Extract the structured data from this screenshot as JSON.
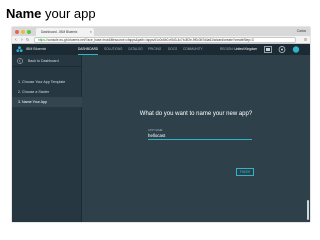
{
  "slide": {
    "heading_bold": "Name",
    "heading_rest": " your app"
  },
  "browser": {
    "tab_title": "Dashboard - IBM Bluemix",
    "tab_close": "×",
    "user": "Carlos",
    "url_scheme": "https://",
    "url_rest": "console.eu-gb.bluemix.net/?ace_base=true&filesource=cfapps&path=/apps/d1c0c6b0-e5d3-4c7b-8f2e-9f0c3b7d4a61/wizard/create?createStep=3",
    "back_icon": "back-arrow",
    "forward_icon": "forward-arrow",
    "reload_icon": "reload"
  },
  "topnav": {
    "brand": "IBM Bluemix",
    "items": [
      "DASHBOARD",
      "SOLUTIONS",
      "CATALOG",
      "PRICING",
      "DOCS",
      "COMMUNITY"
    ],
    "active_index": 0,
    "region_label": "REGION:",
    "region_value": "United Kingdom"
  },
  "sidebar": {
    "back_label": "Back to Dashboard",
    "steps": [
      {
        "label": "1. Choose Your App Template"
      },
      {
        "label": "2. Choose a Starter"
      },
      {
        "label": "3. Name Your App"
      }
    ],
    "active_step": 2
  },
  "main": {
    "question": "What do you want to name your new app?",
    "field_label": "APP NAME:",
    "app_name": "hellocast",
    "finish_label": "FINISH"
  },
  "colors": {
    "accent": "#2fb4c8",
    "panel": "#2e414b",
    "sidebar": "#263741",
    "nav": "#1b2a33"
  }
}
